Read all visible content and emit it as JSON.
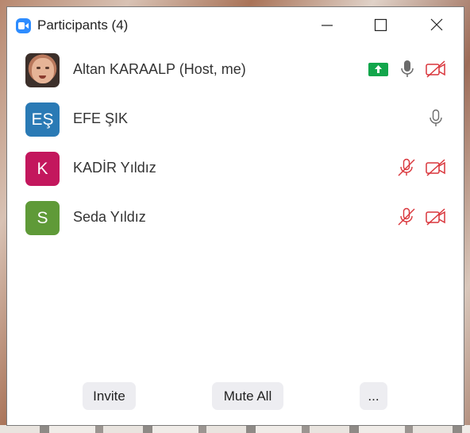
{
  "window": {
    "title": "Participants (4)"
  },
  "participants": [
    {
      "name": "Altan KARAALP (Host, me)",
      "avatar_type": "photo",
      "initials": "",
      "avatar_color": "",
      "sharing": true,
      "mic": "on",
      "video": "off"
    },
    {
      "name": "EFE ŞIK",
      "avatar_type": "initials",
      "initials": "EŞ",
      "avatar_color": "#2a7ab5",
      "sharing": false,
      "mic": "on",
      "video": "none"
    },
    {
      "name": "KADİR Yıldız",
      "avatar_type": "initials",
      "initials": "K",
      "avatar_color": "#c3175d",
      "sharing": false,
      "mic": "muted",
      "video": "off"
    },
    {
      "name": "Seda Yıldız",
      "avatar_type": "initials",
      "initials": "S",
      "avatar_color": "#5f9a38",
      "sharing": false,
      "mic": "muted",
      "video": "off"
    }
  ],
  "footer": {
    "invite_label": "Invite",
    "mute_all_label": "Mute All",
    "more_label": "..."
  },
  "colors": {
    "accent": "#2d8cff",
    "muted_red": "#d9353b",
    "share_green": "#12a64b",
    "mic_gray": "#6b6b6b"
  }
}
